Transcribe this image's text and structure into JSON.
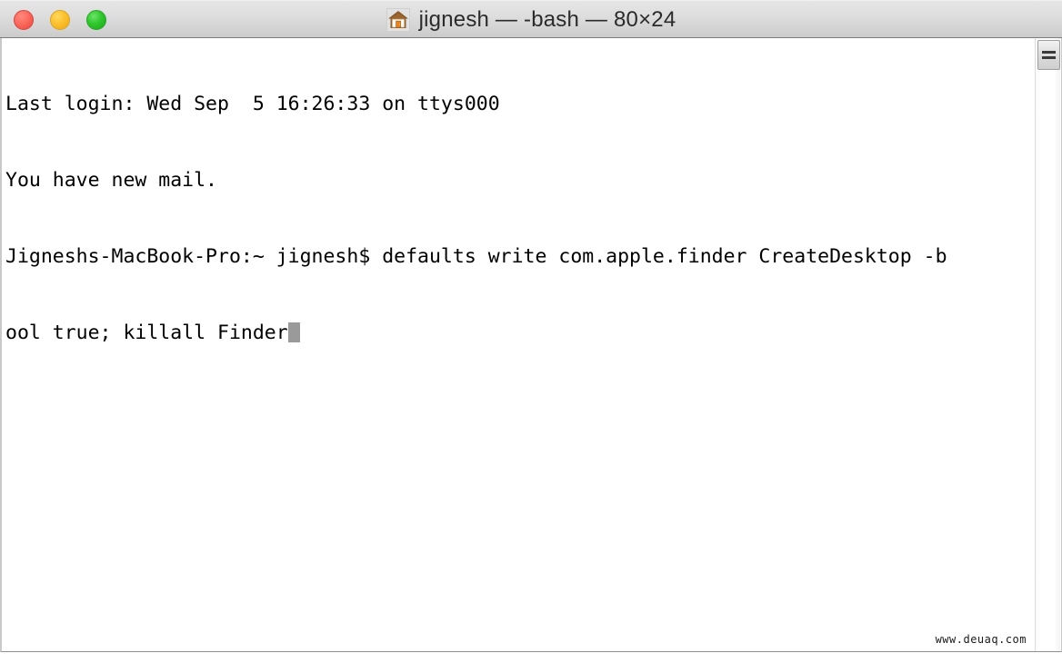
{
  "window": {
    "title": "jignesh — -bash — 80×24",
    "icon": "home-icon",
    "traffic_lights": [
      {
        "name": "close",
        "color": "#fb6a5d",
        "label": "Close"
      },
      {
        "name": "minimize",
        "color": "#fcc02e",
        "label": "Minimize"
      },
      {
        "name": "zoom",
        "color": "#2fc62c",
        "label": "Zoom"
      }
    ]
  },
  "terminal": {
    "lines": [
      "Last login: Wed Sep  5 16:26:33 on ttys000",
      "You have new mail.",
      "Jigneshs-MacBook-Pro:~ jignesh$ defaults write com.apple.finder CreateDesktop -b",
      "ool true; killall Finder"
    ],
    "prompt": "Jigneshs-MacBook-Pro:~ jignesh$",
    "command": "defaults write com.apple.finder CreateDesktop -bool true; killall Finder",
    "columns": 80,
    "rows": 24,
    "shell": "-bash",
    "text_color": "#000000",
    "background_color": "#ffffff",
    "cursor_color": "#9a9a9a"
  },
  "scrollbar": {
    "name": "vertical-scrollbar",
    "thumb_position": "top"
  },
  "watermark": {
    "text": "www.deuaq.com"
  }
}
